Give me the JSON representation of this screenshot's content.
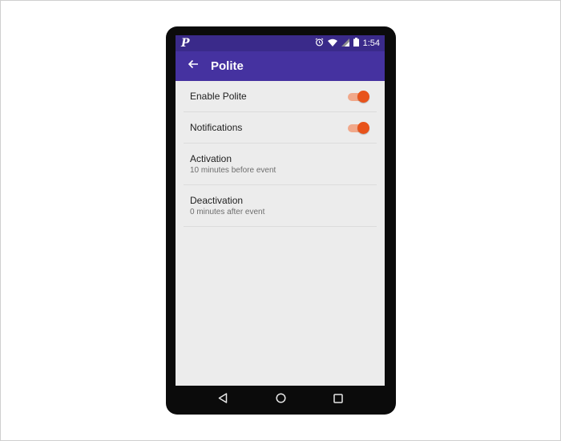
{
  "status_bar": {
    "app_icon": "P",
    "time": "1:54",
    "icons": [
      "alarm-icon",
      "wifi-icon",
      "signal-icon",
      "battery-icon"
    ]
  },
  "app_bar": {
    "title": "Polite",
    "back_icon": "arrow-left-icon"
  },
  "settings": {
    "enable_polite": {
      "label": "Enable Polite",
      "enabled": true
    },
    "notifications": {
      "label": "Notifications",
      "enabled": true
    },
    "activation": {
      "label": "Activation",
      "value": "10 minutes before event"
    },
    "deactivation": {
      "label": "Deactivation",
      "value": "0 minutes after event"
    }
  },
  "nav_bar": {
    "buttons": [
      "back-triangle-icon",
      "home-circle-icon",
      "recents-square-icon"
    ]
  },
  "colors": {
    "status_bar": "#3a2a8a",
    "app_bar": "#4532a0",
    "accent": "#e8531b",
    "accent_track": "#f1a88a",
    "background": "#ececec"
  }
}
